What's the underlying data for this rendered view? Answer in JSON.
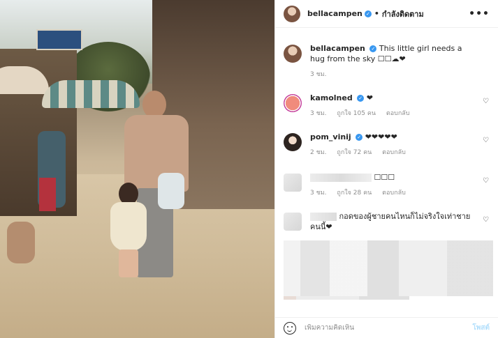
{
  "post": {
    "username": "bellacampen",
    "verified_icon": "verified-badge-icon",
    "follow_label": "กำลังติดตาม",
    "more_label": "•••"
  },
  "caption": {
    "username": "bellacampen",
    "text": "This little girl needs a hug from the sky ☐☐☁❤",
    "time": "3 ชม."
  },
  "comments": [
    {
      "username": "kamolned",
      "text": "❤",
      "time": "3 ชม.",
      "likes": "ถูกใจ 105 คน",
      "reply": "ตอบกลับ"
    },
    {
      "username": "pom_vinij",
      "text": "❤❤❤❤❤",
      "time": "2 ชม.",
      "likes": "ถูกใจ 72 คน",
      "reply": "ตอบกลับ"
    },
    {
      "username": "",
      "text": "☐☐☐",
      "time": "3 ชม.",
      "likes": "ถูกใจ 28 คน",
      "reply": "ตอบกลับ"
    },
    {
      "username": "",
      "text": "กอดของผู้ชายคนไหนก็ไม่จริงใจเท่าชายคนนี้❤"
    }
  ],
  "add_comment": {
    "placeholder": "เพิ่มความคิดเห็น",
    "post_label": "โพสต์"
  }
}
